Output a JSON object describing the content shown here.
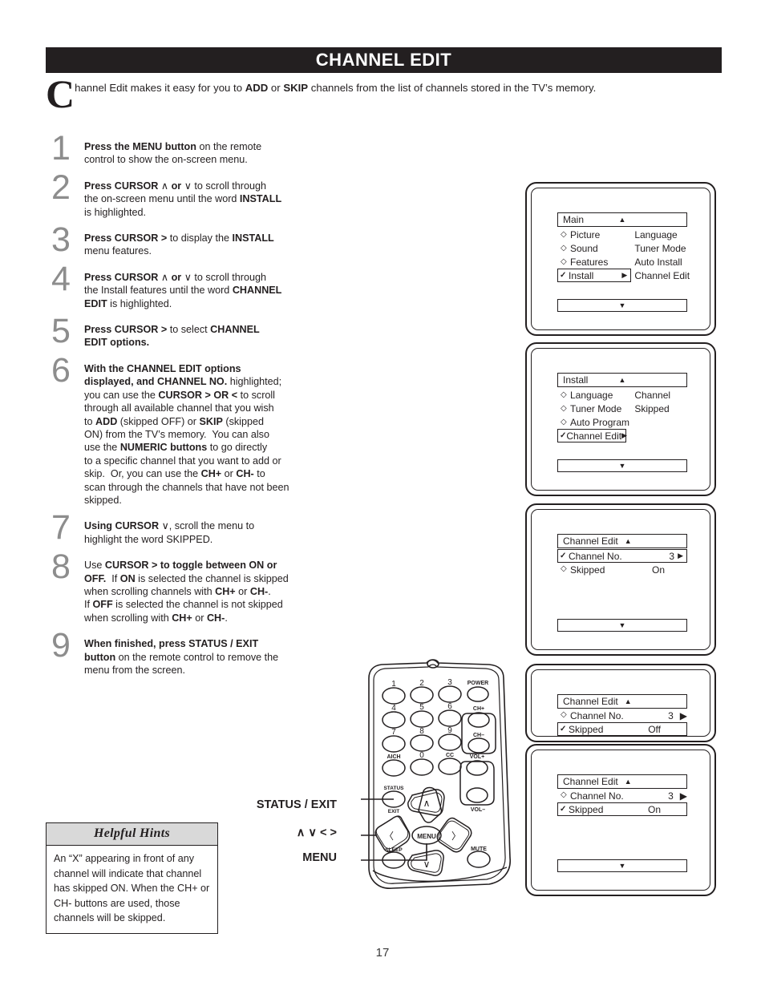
{
  "header": {
    "title": "CHANNEL EDIT"
  },
  "intro": {
    "dropcap": "C",
    "text_1": "hannel Edit makes it easy for you to ",
    "bold_1": "ADD",
    "text_2": " or ",
    "bold_2": "SKIP",
    "text_3": " channels from the list of channels stored in the TV’s memory."
  },
  "steps": [
    {
      "num": "1",
      "html": "<b>Press the MENU button</b> on the remote<br>control to show the on-screen menu."
    },
    {
      "num": "2",
      "html": "<b>Press CURSOR</b> <span class=\"ar\">∧</span> <b>or</b> <span class=\"ar\">∨</span> to scroll through<br>the on-screen menu until the word <b>INSTALL</b><br>is highlighted."
    },
    {
      "num": "3",
      "html": "<b>Press CURSOR &gt;</b> to display the <b>INSTALL</b><br>menu features."
    },
    {
      "num": "4",
      "html": "<b>Press CURSOR</b> <span class=\"ar\">∧</span> <b>or</b> <span class=\"ar\">∨</span> to scroll through<br>the Install features until the word <b>CHANNEL<br>EDIT</b> is highlighted."
    },
    {
      "num": "5",
      "html": "<b>Press CURSOR &gt;</b> to select <b>CHANNEL<br>EDIT options.</b>"
    },
    {
      "num": "6",
      "html": "<b>With the CHANNEL EDIT options<br>displayed, and CHANNEL NO.</b> highlighted;<br>you can use the <b>CURSOR &gt; OR &lt;</b> to scroll<br>through all available channel that you wish<br>to <b>ADD</b> (skipped OFF) or <b>SKIP</b> (skipped<br>ON) from the TV’s memory.&nbsp; You can also<br>use the <b>NUMERIC buttons</b> to go directly<br>to a specific channel that you want to add or<br>skip.&nbsp; Or, you can use the <b>CH+</b> or <b>CH-</b> to<br>scan through the channels that have not been<br>skipped."
    },
    {
      "num": "7",
      "html": "<b>Using CURSOR</b> <span class=\"ar\">∨</span>, scroll the menu to<br>highlight the word SKIPPED."
    },
    {
      "num": "8",
      "html": "Use <b>CURSOR &gt; to toggle between ON or<br>OFF.</b>&nbsp; If <b>ON</b> is selected the channel is skipped<br>when scrolling channels with <b>CH+</b> or <b>CH-</b>.<br>If <b>OFF</b> is selected the channel is not skipped<br>when scrolling with <b>CH+</b> or <b>CH-</b>."
    },
    {
      "num": "9",
      "html": "<b>When finished, press STATUS / EXIT<br>button</b> on the remote control to remove the<br>menu from the screen."
    }
  ],
  "hints": {
    "title": "Helpful Hints",
    "body": "An “X” appearing in front of any channel will indicate that channel has skipped ON.  When the CH+ or CH- buttons are used, those channels will be skipped."
  },
  "tv_screens": [
    {
      "name": "main-menu",
      "title": "Main",
      "up_arrow": "▲",
      "down_arrow": "▼",
      "left_items": [
        {
          "bullet": "◇",
          "label": "Picture",
          "selected": false
        },
        {
          "bullet": "◇",
          "label": "Sound",
          "selected": false
        },
        {
          "bullet": "◇",
          "label": "Features",
          "selected": false
        },
        {
          "bullet": "✓",
          "label": "Install",
          "selected": true,
          "arrow": "▶"
        }
      ],
      "right_items": [
        "Language",
        "Tuner Mode",
        "Auto Install",
        "Channel Edit"
      ]
    },
    {
      "name": "install-menu",
      "title": "Install",
      "up_arrow": "▲",
      "down_arrow": "▼",
      "left_items": [
        {
          "bullet": "◇",
          "label": "Language",
          "selected": false
        },
        {
          "bullet": "◇",
          "label": "Tuner Mode",
          "selected": false
        },
        {
          "bullet": "◇",
          "label": "Auto Program",
          "selected": false
        },
        {
          "bullet": "✓",
          "label": "Channel Edit",
          "selected": true,
          "arrow": "▶"
        }
      ],
      "right_items": [
        "Channel",
        "Skipped"
      ]
    },
    {
      "name": "channel-edit-chno",
      "title": "Channel Edit",
      "up_arrow": "▲",
      "down_arrow": "▼",
      "rows": [
        {
          "bullet": "✓",
          "label": "Channel No.",
          "value": "3",
          "arrow": "▶",
          "selected": true
        },
        {
          "bullet": "◇",
          "label": "Skipped",
          "value": "On",
          "arrow": "",
          "selected": false
        }
      ]
    },
    {
      "name": "channel-edit-skipped-off",
      "title": "Channel Edit",
      "up_arrow": "▲",
      "down_arrow": "",
      "rows": [
        {
          "bullet": "◇",
          "label": "Channel No.",
          "value": "3",
          "arrow": "▶",
          "selected": false
        },
        {
          "bullet": "✓",
          "label": "Skipped",
          "value": "Off",
          "arrow": "",
          "selected": true
        }
      ]
    },
    {
      "name": "channel-edit-skipped-on",
      "title": "Channel Edit",
      "up_arrow": "▲",
      "down_arrow": "▼",
      "rows": [
        {
          "bullet": "◇",
          "label": "Channel No.",
          "value": "3",
          "arrow": "▶",
          "selected": false
        },
        {
          "bullet": "✓",
          "label": "Skipped",
          "value": "On",
          "arrow": "",
          "selected": true
        }
      ]
    }
  ],
  "remote": {
    "keys": [
      "1",
      "2",
      "3",
      "4",
      "5",
      "6",
      "7",
      "8",
      "9",
      "0"
    ],
    "power_label": "POWER",
    "ch_up_label": "CH+",
    "ch_down_label": "CH–",
    "vol_up_label": "VOL+",
    "vol_down_label": "VOL–",
    "aich_label": "AICH",
    "cc_label": "CC",
    "status_label": "STATUS",
    "exit_label": "EXIT",
    "sleep_label": "SLEEP",
    "mute_label": "MUTE",
    "menu_label": "MENU",
    "cursor_up": "∧",
    "cursor_down": "∨",
    "cursor_left": "⟨",
    "cursor_right": "⟩"
  },
  "callouts": {
    "status_exit": "STATUS / EXIT",
    "cursor": "∧ ∨ < >",
    "menu": "MENU"
  },
  "page_number": "17"
}
